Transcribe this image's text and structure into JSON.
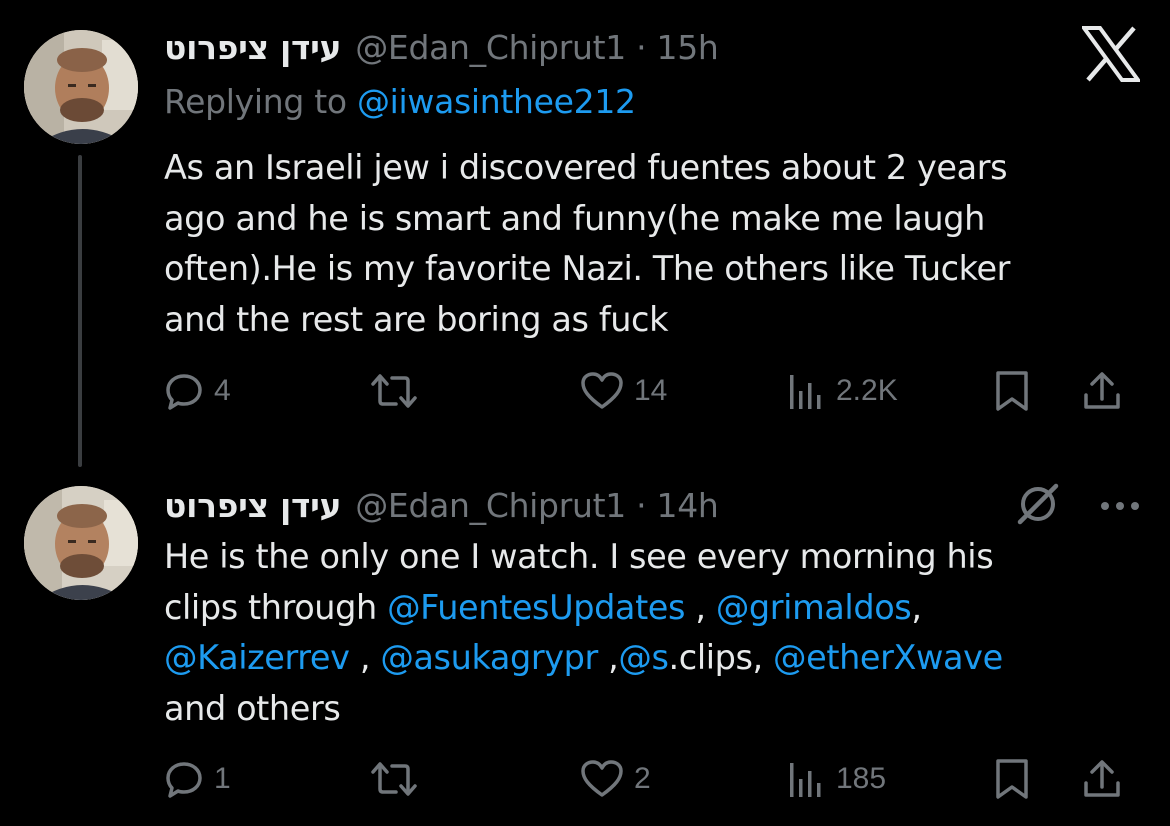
{
  "tweets": [
    {
      "display_name": "עידן ציפרוט",
      "handle": "@Edan_Chiprut1",
      "separator": "·",
      "time": "15h",
      "replying_prefix": "Replying to",
      "replying_handle": "@iiwasinthee212",
      "body_lines": [
        "As an Israeli jew i discovered fuentes about 2 years",
        "ago and he is smart and funny(he make me laugh",
        "often).He is my favorite Nazi. The others like Tucker",
        "and the rest are boring as fuck"
      ],
      "replies": "4",
      "likes": "14",
      "views": "2.2K"
    },
    {
      "display_name": "עידן ציפרוט",
      "handle": "@Edan_Chiprut1",
      "separator": "·",
      "time": "14h",
      "body": {
        "line1": "He is the only one I watch. I see every morning his",
        "line2_prefix": "clips through ",
        "mention1": "@FuentesUpdates",
        "sep1": " , ",
        "mention2": "@grimaldos",
        "sep2": ",",
        "mention3": "@Kaizerrev",
        "sep3": " , ",
        "mention4": "@asukagrypr",
        "sep4": " ,",
        "mention5": "@s",
        "sep5": ".clips, ",
        "mention6": "@etherXwave",
        "line4": "and others"
      },
      "replies": "1",
      "likes": "2",
      "views": "185"
    }
  ],
  "icons": {
    "app_logo": "x-logo-icon",
    "grok": "grok-slash-icon",
    "more": "more-dots-icon",
    "reply": "reply-icon",
    "retweet": "retweet-icon",
    "like": "heart-icon",
    "views": "views-bar-icon",
    "bookmark": "bookmark-icon",
    "share": "share-icon"
  },
  "colors": {
    "background": "#000000",
    "text_primary": "#e7e9ea",
    "text_secondary": "#71767b",
    "link": "#1d9bf0",
    "thread_line": "#3a3d40"
  }
}
